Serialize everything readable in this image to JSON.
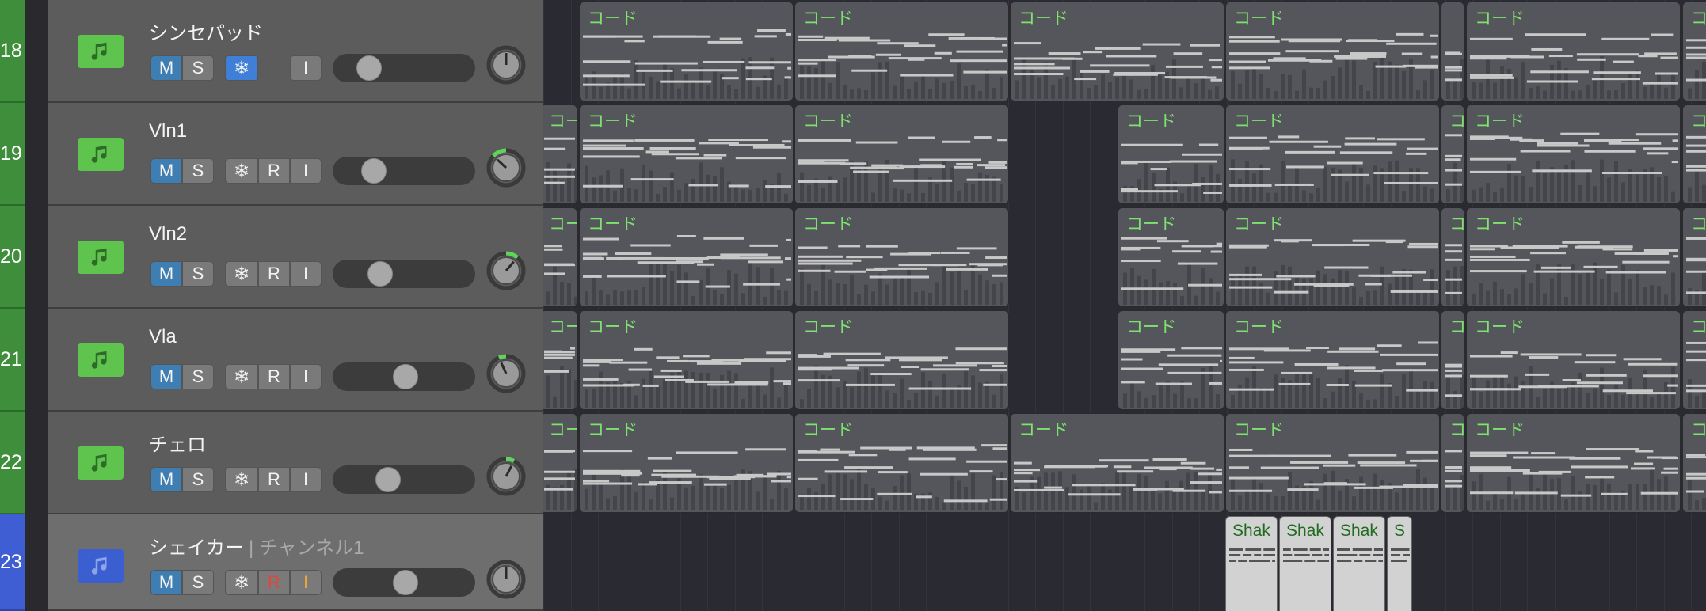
{
  "tracks": [
    {
      "number": "18",
      "name": "シンセパッド",
      "channel": "",
      "color": "#5fc44e",
      "mute": "M",
      "solo": "S",
      "freeze_icon": "snowflake-icon",
      "record": "",
      "input": "I",
      "freeze_active": true,
      "volume": 0.18,
      "pan": 0.0,
      "pan_color": "#5fd35a"
    },
    {
      "number": "19",
      "name": "Vln1",
      "channel": "",
      "color": "#5fc44e",
      "mute": "M",
      "solo": "S",
      "freeze_icon": "snowflake-icon",
      "record": "R",
      "input": "I",
      "freeze_active": false,
      "volume": 0.22,
      "pan": -0.35,
      "pan_color": "#5fd35a"
    },
    {
      "number": "20",
      "name": "Vln2",
      "channel": "",
      "color": "#5fc44e",
      "mute": "M",
      "solo": "S",
      "freeze_icon": "snowflake-icon",
      "record": "R",
      "input": "I",
      "freeze_active": false,
      "volume": 0.28,
      "pan": 0.3,
      "pan_color": "#5fd35a"
    },
    {
      "number": "21",
      "name": "Vla",
      "channel": "",
      "color": "#5fc44e",
      "mute": "M",
      "solo": "S",
      "freeze_icon": "snowflake-icon",
      "record": "R",
      "input": "I",
      "freeze_active": false,
      "volume": 0.5,
      "pan": -0.18,
      "pan_color": "#5fd35a"
    },
    {
      "number": "22",
      "name": "チェロ",
      "channel": "",
      "color": "#5fc44e",
      "mute": "M",
      "solo": "S",
      "freeze_icon": "snowflake-icon",
      "record": "R",
      "input": "I",
      "freeze_active": false,
      "volume": 0.35,
      "pan": 0.2,
      "pan_color": "#5fd35a"
    },
    {
      "number": "23",
      "name": "シェイカー",
      "channel": "| チャンネル1",
      "color": "#3b5fd1",
      "mute": "M",
      "solo": "S",
      "freeze_icon": "snowflake-icon",
      "record": "R",
      "input": "I",
      "freeze_active": false,
      "volume": 0.5,
      "pan": 0.0,
      "pan_color": "#5fd35a"
    }
  ],
  "regions": {
    "chord_label": "コード",
    "chord_label_cut": "コー",
    "chord_label_char": "コ",
    "shaker_label": "Shak",
    "shaker_label_short": "S",
    "region_color": "#55565b",
    "label_color": "#7ee36e"
  }
}
